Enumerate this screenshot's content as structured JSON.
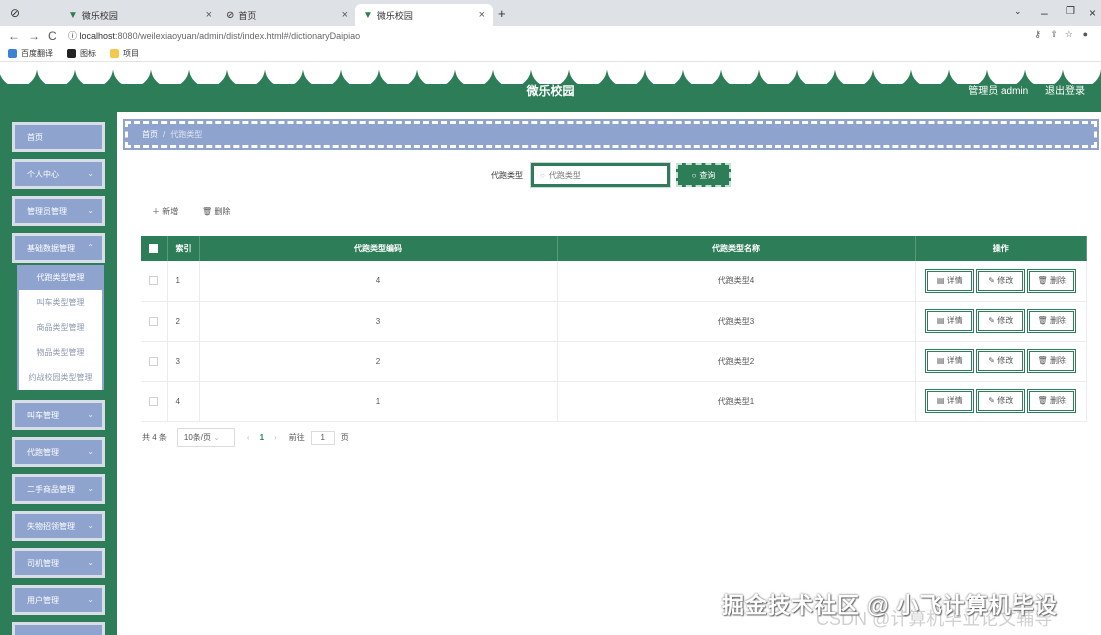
{
  "browser": {
    "tabs": [
      {
        "label": "微乐校园"
      },
      {
        "label": "首页"
      },
      {
        "label": "微乐校园"
      }
    ],
    "new_tab": "+",
    "url_host": "localhost",
    "url_rest": ":8080/weilexiaoyuan/admin/dist/index.html#/dictionaryDaipiao",
    "bookmarks": [
      "百度翻译",
      "图标",
      "项目"
    ]
  },
  "header": {
    "title": "微乐校园",
    "admin_label": "管理员 admin",
    "logout_label": "退出登录"
  },
  "sidebar": {
    "items": [
      {
        "label": "首页",
        "has_chevron": false
      },
      {
        "label": "个人中心",
        "has_chevron": true
      },
      {
        "label": "管理员管理",
        "has_chevron": true
      },
      {
        "label": "基础数据管理",
        "has_chevron": true
      }
    ],
    "submenu": [
      {
        "label": "代跑类型管理",
        "active": true
      },
      {
        "label": "叫车类型管理",
        "active": false
      },
      {
        "label": "商品类型管理",
        "active": false
      },
      {
        "label": "物品类型管理",
        "active": false
      },
      {
        "label": "约战校园类型管理",
        "active": false
      }
    ],
    "items_after": [
      {
        "label": "叫车管理"
      },
      {
        "label": "代跑管理"
      },
      {
        "label": "二手商品管理"
      },
      {
        "label": "失物招领管理"
      },
      {
        "label": "司机管理"
      },
      {
        "label": "用户管理"
      }
    ]
  },
  "breadcrumb": {
    "home": "首页",
    "separator": "/",
    "current": "代跑类型"
  },
  "search": {
    "label": "代跑类型",
    "placeholder": "代跑类型",
    "button_label": "查询"
  },
  "actions": {
    "add_label": "新增",
    "delete_label": "删除"
  },
  "table": {
    "headers": {
      "index": "索引",
      "code": "代跑类型编码",
      "name": "代跑类型名称",
      "ops": "操作"
    },
    "rows": [
      {
        "index": "1",
        "code": "4",
        "name": "代跑类型4"
      },
      {
        "index": "2",
        "code": "3",
        "name": "代跑类型3"
      },
      {
        "index": "3",
        "code": "2",
        "name": "代跑类型2"
      },
      {
        "index": "4",
        "code": "1",
        "name": "代跑类型1"
      }
    ],
    "row_actions": {
      "detail": "详情",
      "edit": "修改",
      "delete": "删除"
    }
  },
  "pagination": {
    "total": "共 4 条",
    "page_size": "10条/页",
    "current_page": "1",
    "goto_label": "前往",
    "goto_value": "1",
    "page_suffix": "页"
  },
  "watermark": {
    "main": "掘金技术社区 @ 小飞计算机毕设",
    "sub": "CSDN @计算机毕业论文辅导"
  },
  "colors": {
    "primary_green": "#2e7d59",
    "menu_blue": "#8fa3cf"
  }
}
